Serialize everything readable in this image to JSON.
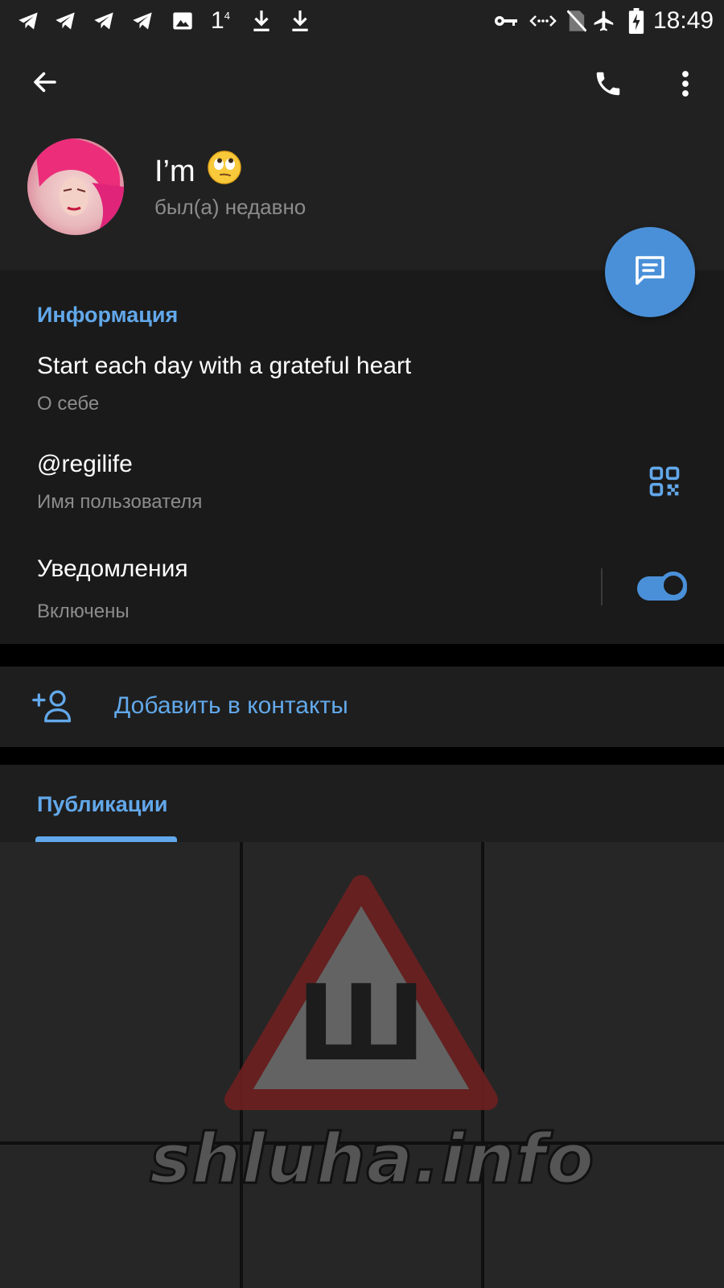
{
  "status_bar": {
    "left_icons": [
      "telegram-icon",
      "telegram-icon",
      "telegram-icon",
      "telegram-icon",
      "image-icon",
      "temperature-icon",
      "download-icon",
      "download-icon"
    ],
    "temp_value": "1",
    "temp_sup": "4",
    "right_icons": [
      "vpn-key-icon",
      "data-saver-icon",
      "no-sim-icon",
      "airplane-icon",
      "battery-charging-icon"
    ],
    "time": "18:49"
  },
  "toolbar": {
    "back_icon": "arrow-back-icon",
    "call_icon": "phone-icon",
    "menu_icon": "more-vert-icon"
  },
  "profile": {
    "name": "I’m",
    "emoji": "🙄",
    "last_seen": "был(а) недавно"
  },
  "fab": {
    "icon": "message-icon"
  },
  "info": {
    "title": "Информация",
    "bio": "Start each day with a grateful heart",
    "bio_label": "О себе",
    "username": "@regilife",
    "username_label": "Имя пользователя",
    "notifications": "Уведомления",
    "notifications_status": "Включены",
    "notifications_enabled": true
  },
  "add_contact": {
    "label": "Добавить в контакты",
    "icon": "person-add-icon"
  },
  "publications": {
    "tab_label": "Публикации"
  },
  "watermark": {
    "text": "shluha.info",
    "glyph": "Ш"
  },
  "colors": {
    "accent": "#62a8ea",
    "fab": "#4a90d9",
    "background": "#1a1a1a",
    "header": "#212121",
    "secondary_text": "#8c8c8c"
  }
}
